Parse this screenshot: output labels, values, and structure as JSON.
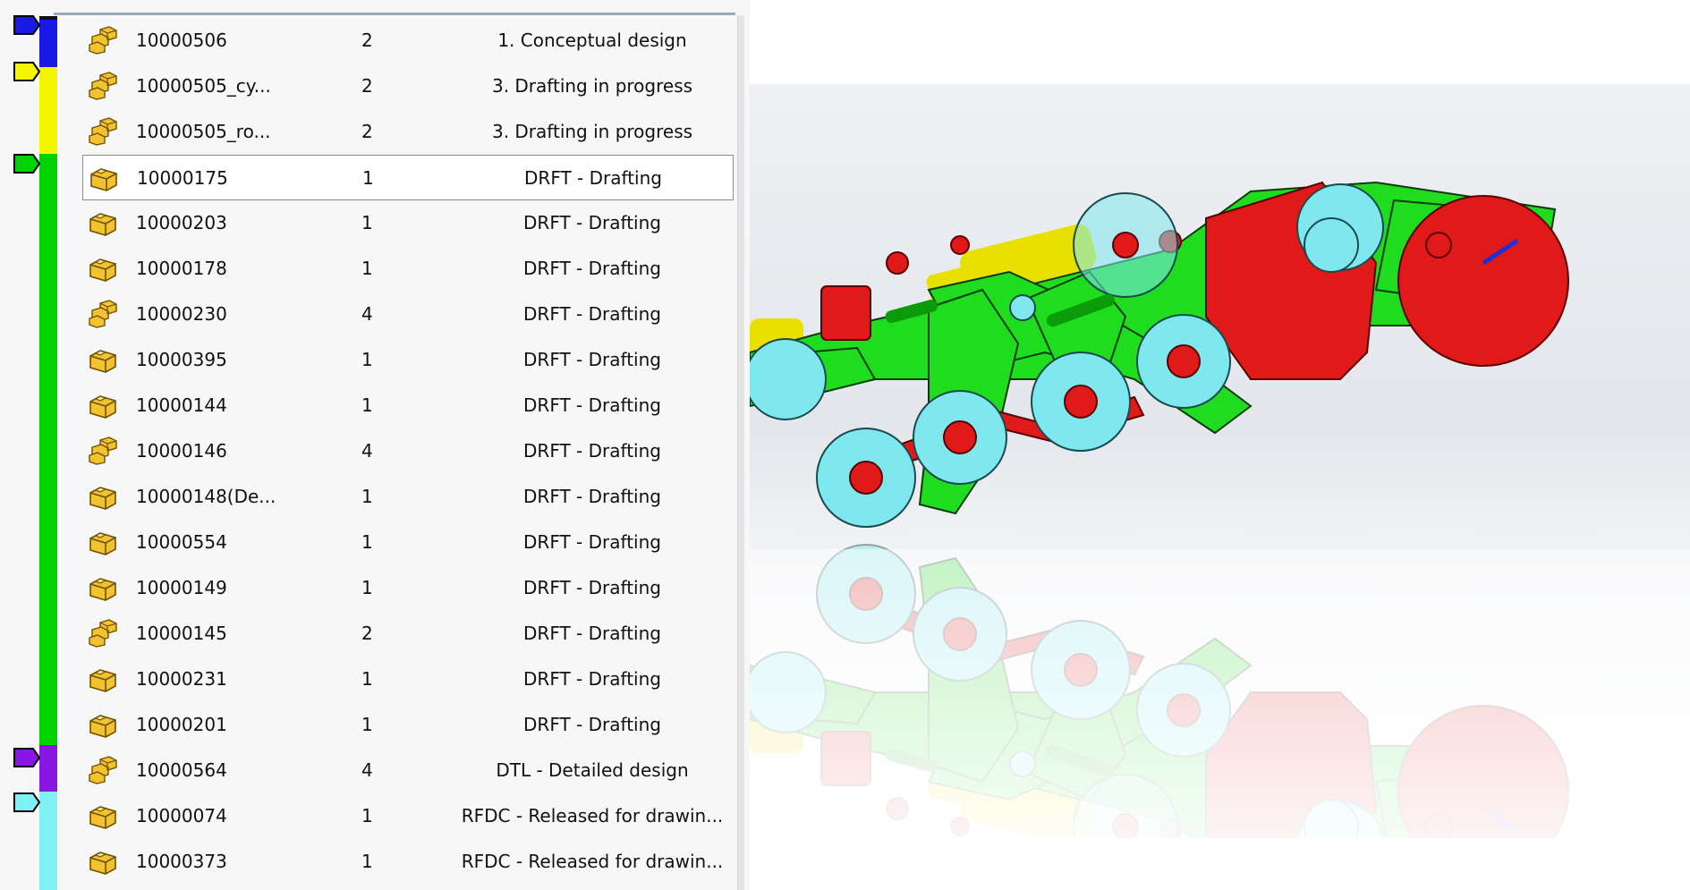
{
  "file_list": {
    "rows": [
      {
        "name": "10000506",
        "qty": "2",
        "state": "1. Conceptual design",
        "icon": "assembly-icon",
        "selected": false
      },
      {
        "name": "10000505_cy...",
        "qty": "2",
        "state": "3. Drafting in progress",
        "icon": "assembly-icon",
        "selected": false
      },
      {
        "name": "10000505_ro...",
        "qty": "2",
        "state": "3. Drafting in progress",
        "icon": "assembly-icon",
        "selected": false
      },
      {
        "name": "10000175",
        "qty": "1",
        "state": "DRFT - Drafting",
        "icon": "part-icon",
        "selected": true
      },
      {
        "name": "10000203",
        "qty": "1",
        "state": "DRFT - Drafting",
        "icon": "part-icon",
        "selected": false
      },
      {
        "name": "10000178",
        "qty": "1",
        "state": "DRFT - Drafting",
        "icon": "part-icon",
        "selected": false
      },
      {
        "name": "10000230",
        "qty": "4",
        "state": "DRFT - Drafting",
        "icon": "assembly-icon",
        "selected": false
      },
      {
        "name": "10000395",
        "qty": "1",
        "state": "DRFT - Drafting",
        "icon": "part-icon",
        "selected": false
      },
      {
        "name": "10000144",
        "qty": "1",
        "state": "DRFT - Drafting",
        "icon": "part-icon",
        "selected": false
      },
      {
        "name": "10000146",
        "qty": "4",
        "state": "DRFT - Drafting",
        "icon": "assembly-icon",
        "selected": false
      },
      {
        "name": "10000148(De...",
        "qty": "1",
        "state": "DRFT - Drafting",
        "icon": "part-icon",
        "selected": false
      },
      {
        "name": "10000554",
        "qty": "1",
        "state": "DRFT - Drafting",
        "icon": "part-icon",
        "selected": false
      },
      {
        "name": "10000149",
        "qty": "1",
        "state": "DRFT - Drafting",
        "icon": "part-icon",
        "selected": false
      },
      {
        "name": "10000145",
        "qty": "2",
        "state": "DRFT - Drafting",
        "icon": "assembly-icon",
        "selected": false
      },
      {
        "name": "10000231",
        "qty": "1",
        "state": "DRFT - Drafting",
        "icon": "part-icon",
        "selected": false
      },
      {
        "name": "10000201",
        "qty": "1",
        "state": "DRFT - Drafting",
        "icon": "part-icon",
        "selected": false
      },
      {
        "name": "10000564",
        "qty": "4",
        "state": "DTL - Detailed design",
        "icon": "assembly-icon",
        "selected": false
      },
      {
        "name": "10000074",
        "qty": "1",
        "state": "RFDC - Released for drawin...",
        "icon": "part-icon",
        "selected": false
      },
      {
        "name": "10000373",
        "qty": "1",
        "state": "RFDC - Released for drawin...",
        "icon": "part-icon",
        "selected": false
      }
    ]
  },
  "state_colors": {
    "conceptual": "#1a1ae6",
    "drafting_in_progress": "#f5f500",
    "drafting": "#00d400",
    "detailed": "#8a16e6",
    "released": "#7ff0f5"
  },
  "model_colors": {
    "conceptual": "#1a1ae6",
    "drafting_in_progress": "#e8e000",
    "drafting": "#1fdc1f",
    "detailed": "#8a16e6",
    "released": "#7fe8ee",
    "red": "#e01919"
  }
}
